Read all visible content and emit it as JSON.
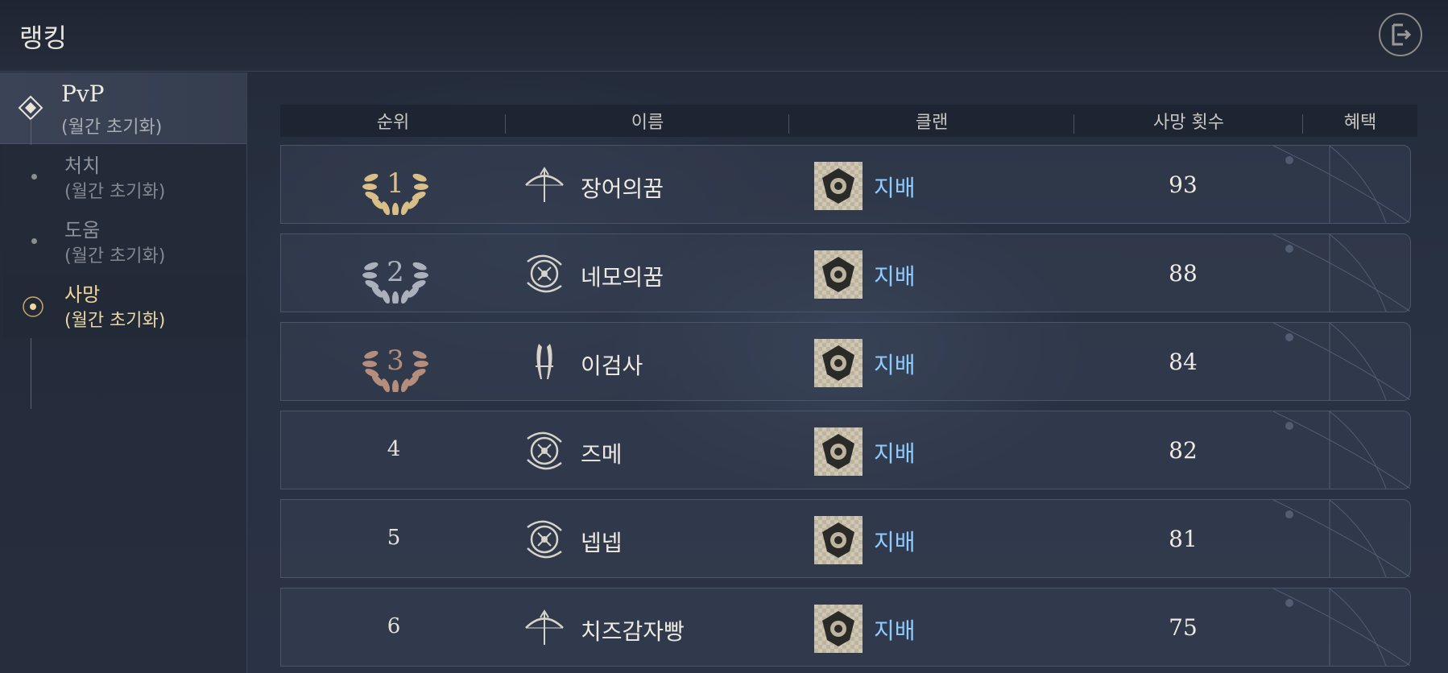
{
  "header": {
    "title": "랭킹",
    "exit_icon": "exit-icon"
  },
  "sidebar": {
    "group": {
      "label": "PvP",
      "sub": "(월간 초기화)",
      "icon": "diamond-icon"
    },
    "items": [
      {
        "label": "처치",
        "sub": "(월간 초기화)",
        "active": false
      },
      {
        "label": "도움",
        "sub": "(월간 초기화)",
        "active": false
      },
      {
        "label": "사망",
        "sub": "(월간 초기화)",
        "active": true
      }
    ]
  },
  "table": {
    "columns": [
      "순위",
      "이름",
      "클랜",
      "사망 횟수",
      "혜택"
    ],
    "rows": [
      {
        "rank": "1",
        "class_icon": "bow-icon",
        "name": "장어의꿈",
        "clan": "지배",
        "deaths": "93"
      },
      {
        "rank": "2",
        "class_icon": "compass-icon",
        "name": "네모의꿈",
        "clan": "지배",
        "deaths": "88"
      },
      {
        "rank": "3",
        "class_icon": "dual-blade-icon",
        "name": "이검사",
        "clan": "지배",
        "deaths": "84"
      },
      {
        "rank": "4",
        "class_icon": "compass-icon",
        "name": "즈메",
        "clan": "지배",
        "deaths": "82"
      },
      {
        "rank": "5",
        "class_icon": "compass-icon",
        "name": "넵넵",
        "clan": "지배",
        "deaths": "81"
      },
      {
        "rank": "6",
        "class_icon": "bow-icon",
        "name": "치즈감자빵",
        "clan": "지배",
        "deaths": "75"
      }
    ]
  },
  "colors": {
    "gold": "#d9bf85",
    "silver": "#aab1bb",
    "bronze": "#b48e7a",
    "clan_text": "#8ecbff",
    "active_menu": "#f2d69a"
  }
}
